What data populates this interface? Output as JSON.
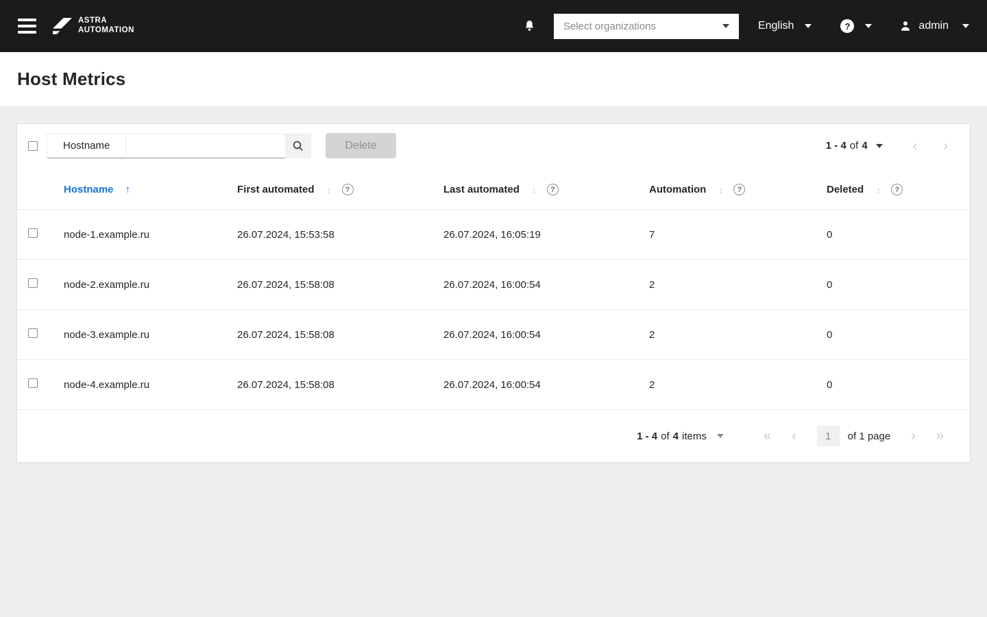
{
  "navbar": {
    "brand_line1": "ASTRA",
    "brand_line2": "AUTOMATION",
    "org_select_placeholder": "Select organizations",
    "language_label": "English",
    "help_glyph": "?",
    "user_name": "admin"
  },
  "page": {
    "title": "Host Metrics"
  },
  "toolbar": {
    "filter_key_label": "Hostname",
    "search_value": "",
    "delete_label": "Delete",
    "pagination": {
      "range": "1 - 4",
      "of_label": "of",
      "total": "4"
    }
  },
  "table": {
    "columns": [
      {
        "label": "Hostname",
        "sorted": "asc"
      },
      {
        "label": "First automated"
      },
      {
        "label": "Last automated"
      },
      {
        "label": "Automation"
      },
      {
        "label": "Deleted"
      }
    ],
    "rows": [
      {
        "hostname": "node-1.example.ru",
        "first_automated": "26.07.2024, 15:53:58",
        "last_automated": "26.07.2024, 16:05:19",
        "automation": "7",
        "deleted": "0"
      },
      {
        "hostname": "node-2.example.ru",
        "first_automated": "26.07.2024, 15:58:08",
        "last_automated": "26.07.2024, 16:00:54",
        "automation": "2",
        "deleted": "0"
      },
      {
        "hostname": "node-3.example.ru",
        "first_automated": "26.07.2024, 15:58:08",
        "last_automated": "26.07.2024, 16:00:54",
        "automation": "2",
        "deleted": "0"
      },
      {
        "hostname": "node-4.example.ru",
        "first_automated": "26.07.2024, 15:58:08",
        "last_automated": "26.07.2024, 16:00:54",
        "automation": "2",
        "deleted": "0"
      }
    ]
  },
  "footer": {
    "items_range": "1 - 4",
    "items_of": "of",
    "items_total": "4",
    "items_label": "items",
    "page_value": "1",
    "page_of_label": "of 1 page"
  },
  "icons": {
    "sort": "↕",
    "sort_asc": "↑",
    "column_help": "?",
    "chevron_left": "‹",
    "chevron_right": "›",
    "first_page": "«",
    "last_page": "»"
  },
  "colors": {
    "accent_blue": "#1774d1",
    "navbar_bg": "#1b1b1b",
    "page_bg": "#efefef",
    "disabled_button_bg": "#d4d4d4"
  }
}
